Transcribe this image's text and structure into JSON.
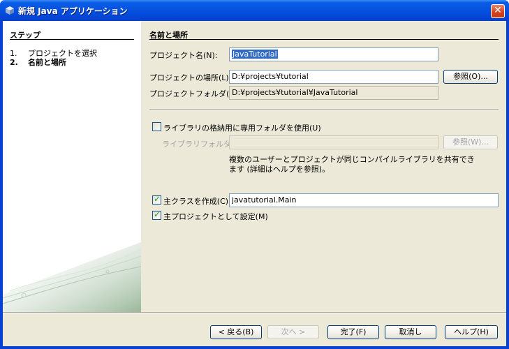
{
  "window": {
    "title": "新規 Java アプリケーション",
    "close_glyph": "✕"
  },
  "steps": {
    "title": "ステップ",
    "items": [
      {
        "num": "1.",
        "label": "プロジェクトを選択"
      },
      {
        "num": "2.",
        "label": "名前と場所"
      }
    ]
  },
  "form": {
    "section_title": "名前と場所",
    "project_name": {
      "label": "プロジェクト名(N):",
      "value": "JavaTutorial"
    },
    "project_location": {
      "label": "プロジェクトの場所(L):",
      "value": "D:¥projects¥tutorial",
      "browse": "参照(O)..."
    },
    "project_folder": {
      "label": "プロジェクトフォルダ(D):",
      "value": "D:¥projects¥tutorial¥JavaTutorial"
    },
    "library": {
      "checkbox_label": "ライブラリの格納用に専用フォルダを使用(U)",
      "checked": false,
      "folder_label": "ライブラリフォルダ(I):",
      "folder_value": "",
      "browse": "参照(W)...",
      "description_line1": "複数のユーザーとプロジェクトが同じコンパイルライブラリを共有でき",
      "description_line2": "ます (詳細はヘルプを参照)。"
    },
    "main_class": {
      "label": "主クラスを作成(C)",
      "checked": true,
      "value": "javatutorial.Main"
    },
    "main_project": {
      "label": "主プロジェクトとして設定(M)",
      "checked": true
    }
  },
  "buttons": {
    "back": "< 戻る(B)",
    "next": "次へ >",
    "finish": "完了(F)",
    "cancel": "取消し",
    "help": "ヘルプ(H)"
  }
}
